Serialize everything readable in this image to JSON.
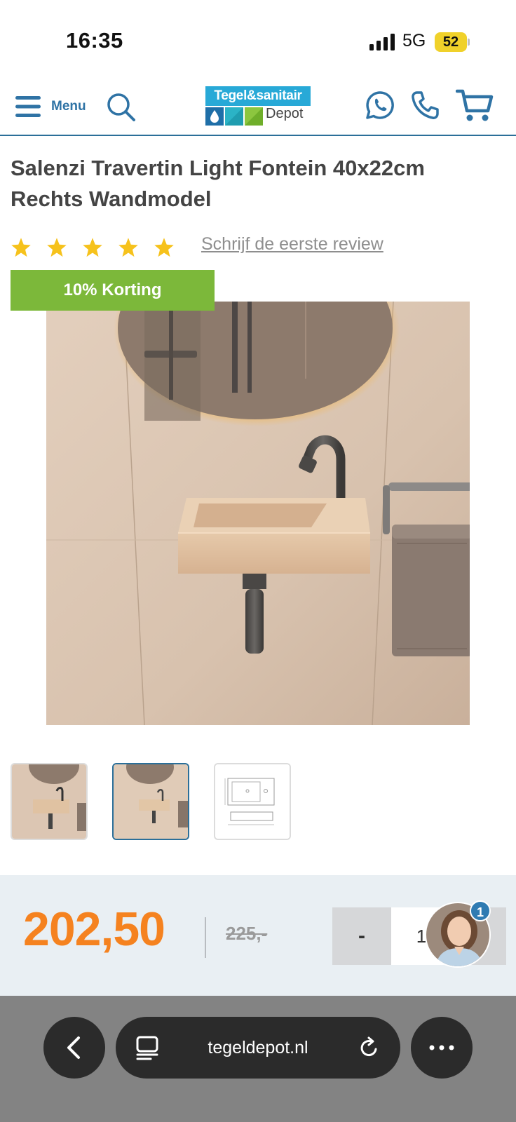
{
  "status_bar": {
    "time": "16:35",
    "network": "5G",
    "battery": "52"
  },
  "header": {
    "menu_label": "Menu",
    "logo": {
      "top_text": "Tegel&sanitair",
      "sub_text": "Depot"
    },
    "icons": [
      "menu-icon",
      "search-icon",
      "whatsapp-icon",
      "phone-icon",
      "cart-icon"
    ]
  },
  "product": {
    "title": "Salenzi Travertin Light Fontein 40x22cm Rechts Wandmodel",
    "rating_stars": 5,
    "review_link": "Schrijf de eerste review",
    "discount_badge": "10% Korting",
    "thumbnails_count": 3,
    "active_thumbnail": 2
  },
  "price_bar": {
    "current_price": "202,50",
    "old_price": "225,-",
    "qty_minus": "-",
    "qty_value": "1",
    "chat_badge": "1"
  },
  "browser": {
    "url": "tegeldepot.nl"
  },
  "colors": {
    "brand_blue": "#2f73a5",
    "discount_green": "#7cb83a",
    "price_orange": "#f5821f",
    "star_yellow": "#f6c21c",
    "logo_cyan": "#28a9d7"
  }
}
